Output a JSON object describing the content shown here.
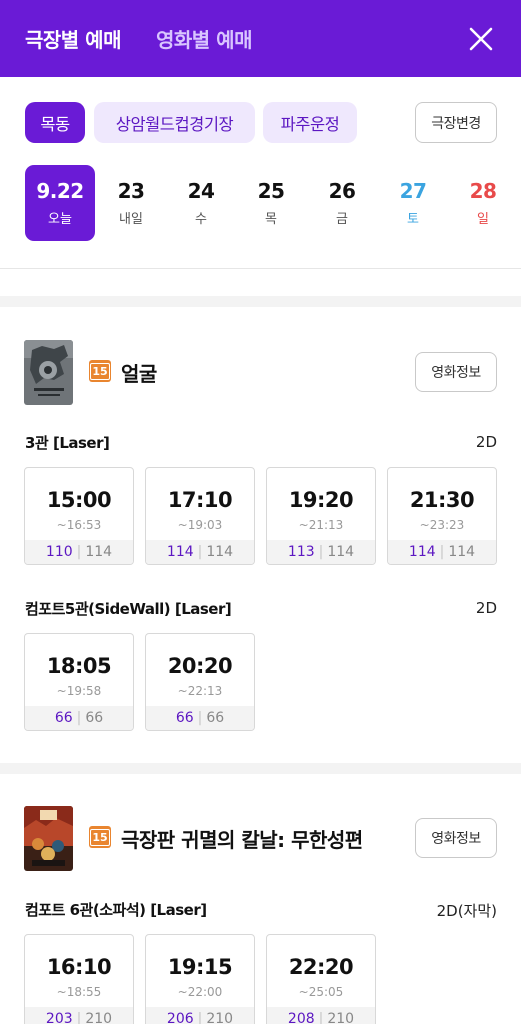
{
  "header": {
    "tab_theater": "극장별 예매",
    "tab_movie": "영화별 예매",
    "close_icon": "close-icon"
  },
  "theaters": {
    "chips": [
      "목동",
      "상암월드컵경기장",
      "파주운정"
    ],
    "change_label": "극장변경"
  },
  "dates": [
    {
      "num": "9.22",
      "day": "오늘"
    },
    {
      "num": "23",
      "day": "내일"
    },
    {
      "num": "24",
      "day": "수"
    },
    {
      "num": "25",
      "day": "목"
    },
    {
      "num": "26",
      "day": "금"
    },
    {
      "num": "27",
      "day": "토"
    },
    {
      "num": "28",
      "day": "일"
    }
  ],
  "colors": {
    "accent": "#6a1bd6",
    "saturday": "#3ba4e0",
    "sunday": "#e84a4a",
    "rating15": "#e9852f"
  },
  "movies": [
    {
      "rating": "15",
      "title": "얼굴",
      "info_label": "영화정보",
      "halls": [
        {
          "name": "3관 [Laser]",
          "format": "2D",
          "times": [
            {
              "start": "15:00",
              "end": "~16:53",
              "avail": "110",
              "total": "114"
            },
            {
              "start": "17:10",
              "end": "~19:03",
              "avail": "114",
              "total": "114"
            },
            {
              "start": "19:20",
              "end": "~21:13",
              "avail": "113",
              "total": "114"
            },
            {
              "start": "21:30",
              "end": "~23:23",
              "avail": "114",
              "total": "114"
            }
          ]
        },
        {
          "name": "컴포트5관(SideWall) [Laser]",
          "format": "2D",
          "times": [
            {
              "start": "18:05",
              "end": "~19:58",
              "avail": "66",
              "total": "66"
            },
            {
              "start": "20:20",
              "end": "~22:13",
              "avail": "66",
              "total": "66"
            }
          ]
        }
      ]
    },
    {
      "rating": "15",
      "title": "극장판 귀멸의 칼날: 무한성편",
      "info_label": "영화정보",
      "halls": [
        {
          "name": "컴포트 6관(소파석) [Laser]",
          "format": "2D(자막)",
          "times": [
            {
              "start": "16:10",
              "end": "~18:55",
              "avail": "203",
              "total": "210"
            },
            {
              "start": "19:15",
              "end": "~22:00",
              "avail": "206",
              "total": "210"
            },
            {
              "start": "22:20",
              "end": "~25:05",
              "avail": "208",
              "total": "210"
            }
          ]
        }
      ]
    }
  ]
}
